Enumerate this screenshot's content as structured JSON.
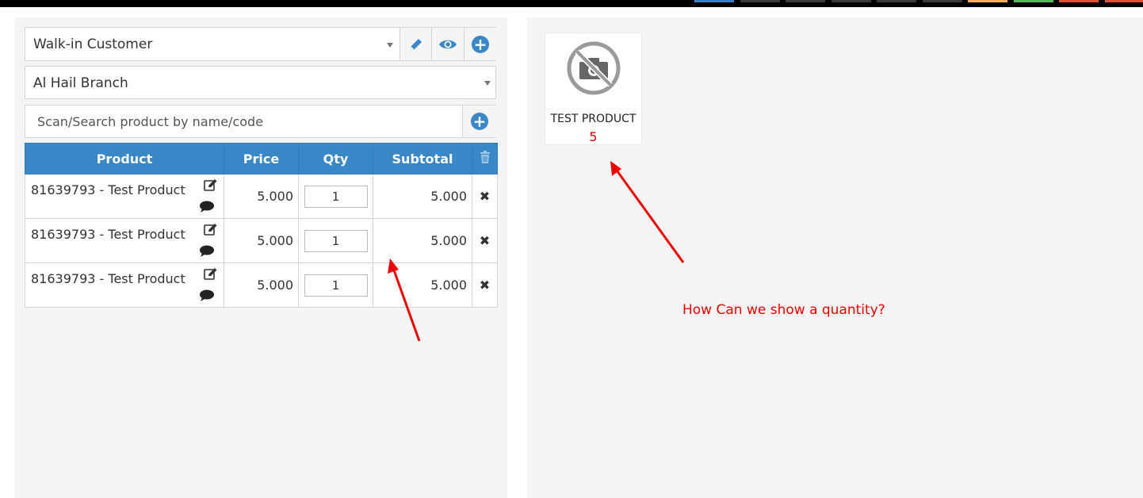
{
  "topbar": {
    "swatches": [
      "#3a7fc4",
      "#3a3a3a",
      "#3a3a3a",
      "#3a3a3a",
      "#3a3a3a",
      "#3a3a3a",
      "#f0ad4e",
      "#5cb85c",
      "#e74c3c",
      "#e74c3c"
    ]
  },
  "pos": {
    "customer_select": {
      "value": "Walk-in Customer"
    },
    "branch_select": {
      "value": "Al Hail Branch"
    },
    "search": {
      "placeholder": "Scan/Search product by name/code"
    },
    "table": {
      "headers": {
        "product": "Product",
        "price": "Price",
        "qty": "Qty",
        "subtotal": "Subtotal"
      },
      "rows": [
        {
          "product": "81639793 - Test Product",
          "price": "5.000",
          "qty": "1",
          "subtotal": "5.000"
        },
        {
          "product": "81639793 - Test Product",
          "price": "5.000",
          "qty": "1",
          "subtotal": "5.000"
        },
        {
          "product": "81639793 - Test Product",
          "price": "5.000",
          "qty": "1",
          "subtotal": "5.000"
        }
      ]
    }
  },
  "products_grid": {
    "items": [
      {
        "name": "TEST PRODUCT",
        "quantity": "5"
      }
    ]
  },
  "annotation": {
    "text": "How Can we show a quantity?"
  },
  "colors": {
    "primary": "#3a87c8",
    "annotation": "#ee0000",
    "panel_bg": "#f4f4f4"
  }
}
